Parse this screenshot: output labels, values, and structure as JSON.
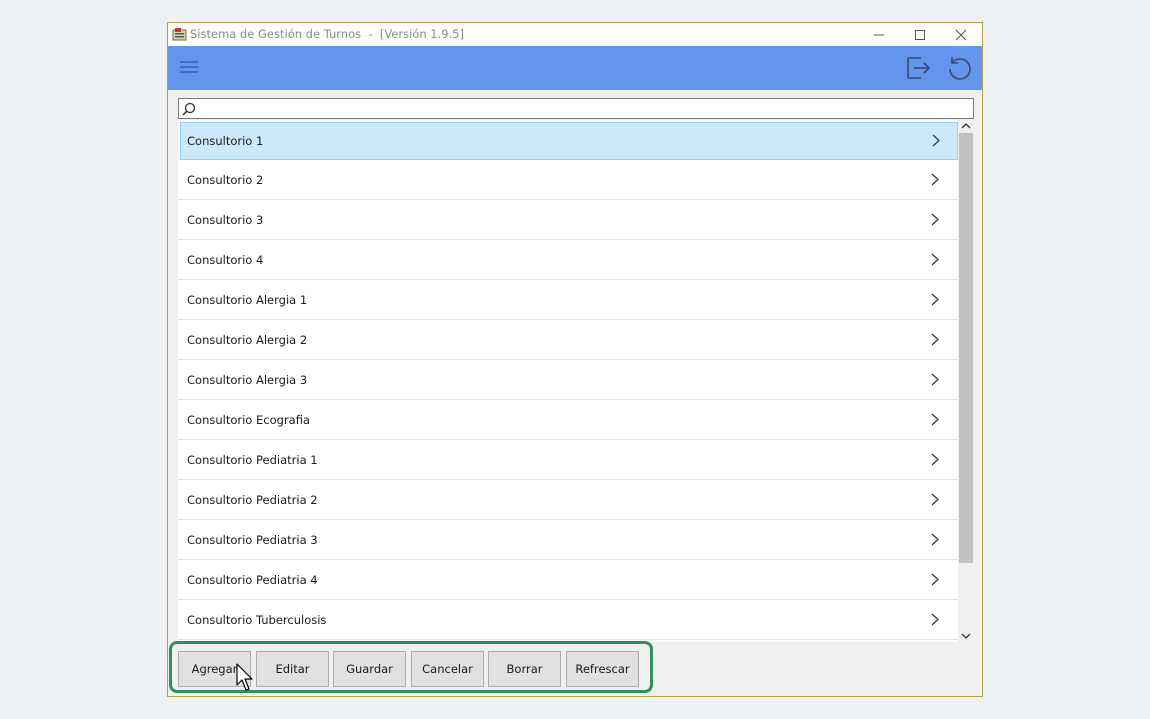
{
  "window": {
    "title": "Sistema de Gestión de Turnos  -  [Versión 1.9.5]",
    "controls": {
      "minimize": "—",
      "maximize": "☐",
      "close": "✕"
    }
  },
  "toolbar": {
    "color": "#6495ed",
    "icons": [
      "menu-icon",
      "exit-icon",
      "refresh-icon"
    ]
  },
  "search": {
    "value": "",
    "placeholder": ""
  },
  "list": {
    "items": [
      {
        "label": "Consultorio 1",
        "selected": true
      },
      {
        "label": "Consultorio 2"
      },
      {
        "label": "Consultorio 3"
      },
      {
        "label": "Consultorio 4"
      },
      {
        "label": "Consultorio Alergia 1"
      },
      {
        "label": "Consultorio Alergia 2"
      },
      {
        "label": "Consultorio Alergia 3"
      },
      {
        "label": "Consultorio Ecografia"
      },
      {
        "label": "Consultorio Pediatria 1"
      },
      {
        "label": "Consultorio Pediatria 2"
      },
      {
        "label": "Consultorio Pediatria 3"
      },
      {
        "label": "Consultorio Pediatria 4"
      },
      {
        "label": "Consultorio Tuberculosis"
      }
    ]
  },
  "buttons": {
    "agregar": "Agregar",
    "editar": "Editar",
    "guardar": "Guardar",
    "cancelar": "Cancelar",
    "borrar": "Borrar",
    "refrescar": "Refrescar"
  },
  "colors": {
    "highlight_border": "#2f8f5f",
    "selected_row": "#cce8fb"
  }
}
